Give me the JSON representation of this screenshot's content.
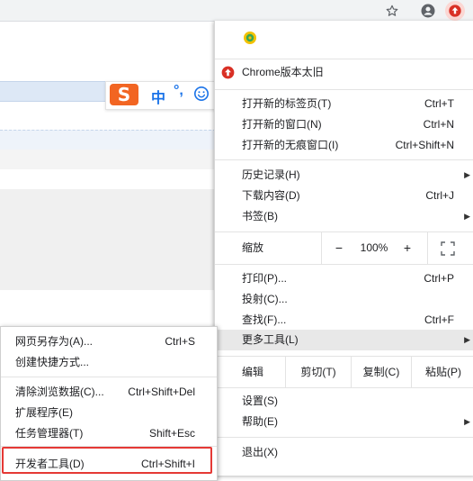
{
  "toolbar": {
    "star_icon": "star-outline-icon",
    "account_icon": "account-circle-icon",
    "update_icon": "chrome-update-arrow-icon"
  },
  "colors": {
    "update_red": "#d93025",
    "update_bg": "#fbd7d3",
    "highlight": "#e8e8e8",
    "red_box": "#e53935",
    "ime_orange": "#f26522",
    "ime_blue": "#1a73e8"
  },
  "ime_bar": {
    "logo": "S",
    "mode": "中",
    "punct": "°,"
  },
  "main_menu": {
    "update_notice": "Chrome版本太旧",
    "new_tab": {
      "label": "打开新的标签页(T)",
      "shortcut": "Ctrl+T"
    },
    "new_window": {
      "label": "打开新的窗口(N)",
      "shortcut": "Ctrl+N"
    },
    "new_incognito": {
      "label": "打开新的无痕窗口(I)",
      "shortcut": "Ctrl+Shift+N"
    },
    "history": {
      "label": "历史记录(H)"
    },
    "downloads": {
      "label": "下载内容(D)",
      "shortcut": "Ctrl+J"
    },
    "bookmarks": {
      "label": "书签(B)"
    },
    "zoom": {
      "label": "缩放",
      "minus": "−",
      "value": "100%",
      "plus": "+"
    },
    "print": {
      "label": "打印(P)...",
      "shortcut": "Ctrl+P"
    },
    "cast": {
      "label": "投射(C)..."
    },
    "find": {
      "label": "查找(F)...",
      "shortcut": "Ctrl+F"
    },
    "more_tools": {
      "label": "更多工具(L)"
    },
    "edit": {
      "label": "编辑",
      "cut": "剪切(T)",
      "copy": "复制(C)",
      "paste": "粘贴(P)"
    },
    "settings": {
      "label": "设置(S)"
    },
    "help": {
      "label": "帮助(E)"
    },
    "exit": {
      "label": "退出(X)"
    }
  },
  "sub_menu": {
    "save_page": {
      "label": "网页另存为(A)...",
      "shortcut": "Ctrl+S"
    },
    "create_shortcut": {
      "label": "创建快捷方式..."
    },
    "clear_data": {
      "label": "清除浏览数据(C)...",
      "shortcut": "Ctrl+Shift+Del"
    },
    "extensions": {
      "label": "扩展程序(E)"
    },
    "task_manager": {
      "label": "任务管理器(T)",
      "shortcut": "Shift+Esc"
    },
    "dev_tools": {
      "label": "开发者工具(D)",
      "shortcut": "Ctrl+Shift+I"
    }
  }
}
